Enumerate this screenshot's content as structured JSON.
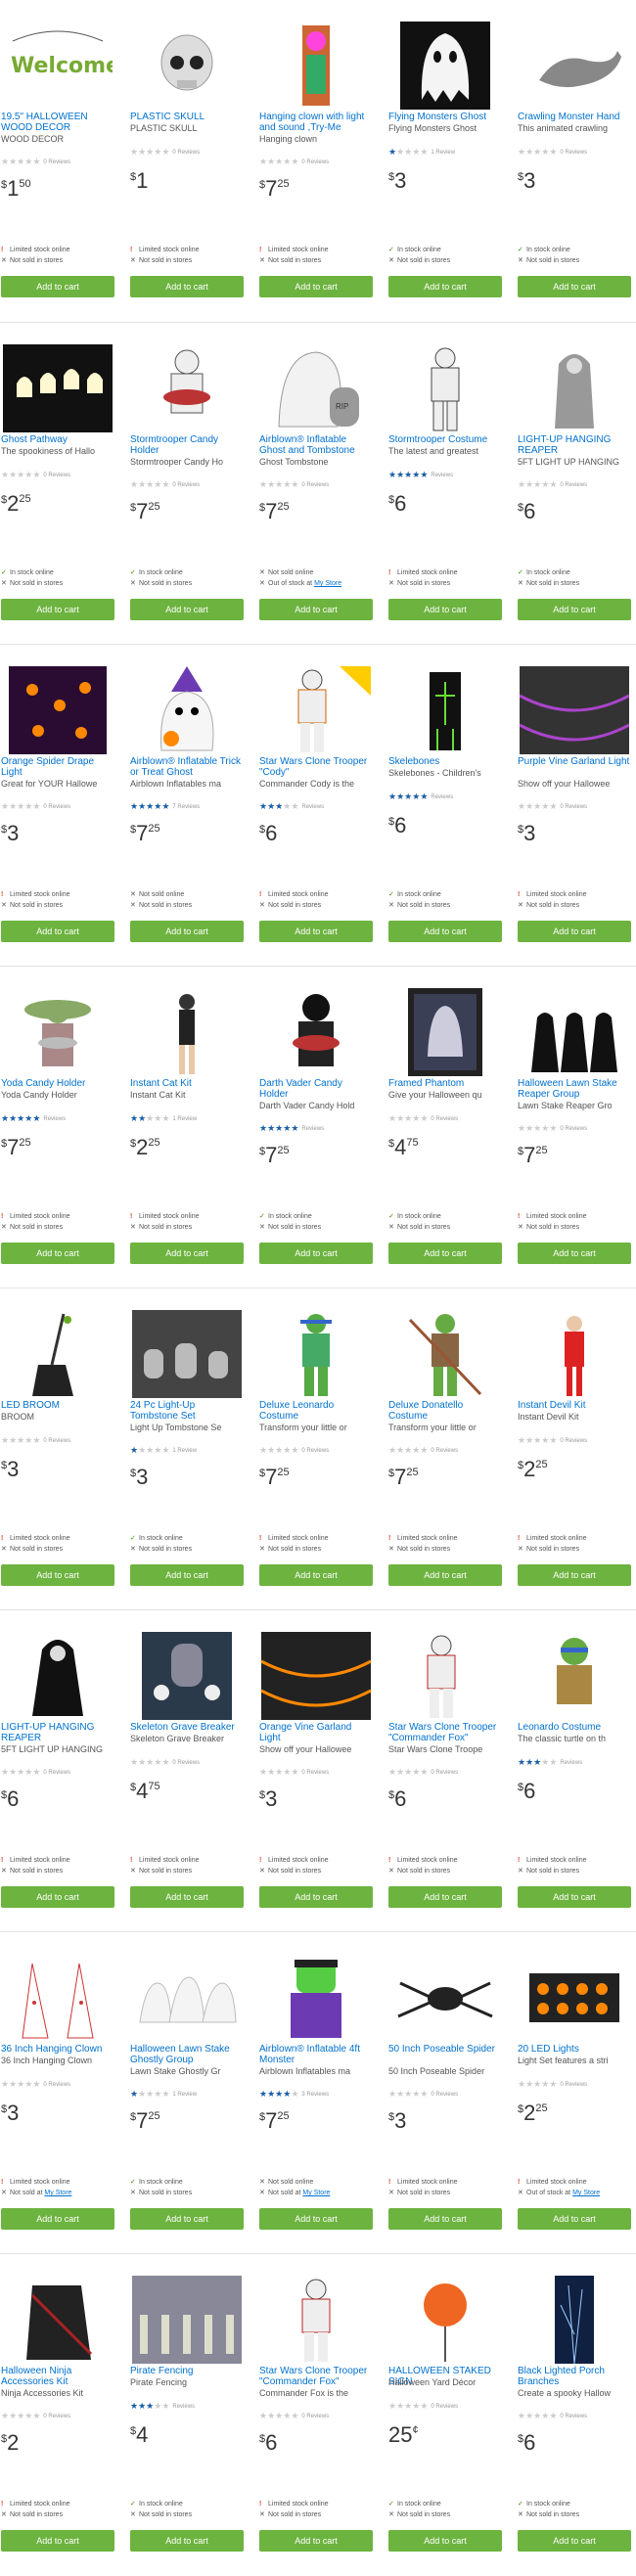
{
  "add_to_cart_label": "Add to cart",
  "products": [
    {
      "title": "19.5\" HALLOWEEN WOOD DECOR",
      "desc": "WOOD DECOR",
      "stars": 0,
      "reviews": "0 Reviews",
      "price_whole": "1",
      "price_cents": "50",
      "avail": [
        {
          "type": "warn",
          "text": "Limited stock online"
        },
        {
          "type": "no",
          "text": "Not sold in stores"
        }
      ],
      "image": "welcome-sign"
    },
    {
      "title": "PLASTIC SKULL",
      "desc": "PLASTIC SKULL",
      "stars": 0,
      "reviews": "0 Reviews",
      "price_whole": "1",
      "price_cents": "",
      "avail": [
        {
          "type": "warn",
          "text": "Limited stock online"
        },
        {
          "type": "no",
          "text": "Not sold in stores"
        }
      ],
      "image": "skull"
    },
    {
      "title": "Hanging clown with light and sound ,Try-Me",
      "desc": "Hanging clown",
      "stars": 0,
      "reviews": "0 Reviews",
      "price_whole": "7",
      "price_cents": "25",
      "avail": [
        {
          "type": "warn",
          "text": "Limited stock online"
        },
        {
          "type": "no",
          "text": "Not sold in stores"
        }
      ],
      "image": "clown"
    },
    {
      "title": "Flying Monsters Ghost",
      "desc": "Flying Monsters Ghost",
      "stars": 1,
      "reviews": "1 Review",
      "price_whole": "3",
      "price_cents": "",
      "avail": [
        {
          "type": "ok",
          "text": "In stock online"
        },
        {
          "type": "no",
          "text": "Not sold in stores"
        }
      ],
      "image": "ghost"
    },
    {
      "title": "Crawling Monster Hand",
      "desc": "This animated crawling",
      "stars": 0,
      "reviews": "0 Reviews",
      "price_whole": "3",
      "price_cents": "",
      "avail": [
        {
          "type": "ok",
          "text": "In stock online"
        },
        {
          "type": "no",
          "text": "Not sold in stores"
        }
      ],
      "image": "hand"
    },
    {
      "title": "Ghost Pathway",
      "desc": "The spookiness of Hallo",
      "stars": 0,
      "reviews": "0 Reviews",
      "price_whole": "2",
      "price_cents": "25",
      "avail": [
        {
          "type": "ok",
          "text": "In stock online"
        },
        {
          "type": "no",
          "text": "Not sold in stores"
        }
      ],
      "image": "pathway"
    },
    {
      "title": "Stormtrooper Candy Holder",
      "desc": "Stormtrooper Candy Ho",
      "stars": 0,
      "reviews": "0 Reviews",
      "price_whole": "7",
      "price_cents": "25",
      "avail": [
        {
          "type": "ok",
          "text": "In stock online"
        },
        {
          "type": "no",
          "text": "Not sold in stores"
        }
      ],
      "image": "trooper-bowl"
    },
    {
      "title": "Airblown® Inflatable Ghost and Tombstone",
      "desc": "Ghost Tombstone",
      "stars": 0,
      "reviews": "0 Reviews",
      "price_whole": "7",
      "price_cents": "25",
      "avail": [
        {
          "type": "no",
          "text": "Not sold online"
        },
        {
          "type": "no",
          "text": "Out of stock at ",
          "link": "My Store"
        }
      ],
      "image": "inflatable-ghost"
    },
    {
      "title": "Stormtrooper Costume",
      "desc": "The latest and greatest",
      "stars": 5,
      "reviews": "Reviews",
      "price_whole": "6",
      "price_cents": "",
      "avail": [
        {
          "type": "warn",
          "text": "Limited stock online"
        },
        {
          "type": "no",
          "text": "Not sold in stores"
        }
      ],
      "image": "trooper-kid"
    },
    {
      "title": "LIGHT-UP HANGING REAPER",
      "desc": "5FT LIGHT UP HANGING",
      "stars": 0,
      "reviews": "0 Reviews",
      "price_whole": "6",
      "price_cents": "",
      "avail": [
        {
          "type": "ok",
          "text": "In stock online"
        },
        {
          "type": "no",
          "text": "Not sold in stores"
        }
      ],
      "image": "reaper-grey"
    },
    {
      "title": "Orange Spider Drape Light",
      "desc": "Great for YOUR Hallowe",
      "stars": 0,
      "reviews": "0 Reviews",
      "price_whole": "3",
      "price_cents": "",
      "avail": [
        {
          "type": "warn",
          "text": "Limited stock online"
        },
        {
          "type": "no",
          "text": "Not sold in stores"
        }
      ],
      "image": "spider-lights"
    },
    {
      "title": "Airblown® Inflatable Trick or Treat Ghost",
      "desc": "Airblown Inflatables ma",
      "stars": 5,
      "reviews": "7 Reviews",
      "price_whole": "7",
      "price_cents": "25",
      "avail": [
        {
          "type": "no",
          "text": "Not sold online"
        },
        {
          "type": "no",
          "text": "Not sold in stores"
        }
      ],
      "image": "witch-ghost"
    },
    {
      "title": "Star Wars Clone Trooper \"Cody\"",
      "desc": "Commander Cody is the",
      "stars": 3,
      "reviews": "Reviews",
      "price_whole": "6",
      "price_cents": "",
      "avail": [
        {
          "type": "warn",
          "text": "Limited stock online"
        },
        {
          "type": "no",
          "text": "Not sold in stores"
        }
      ],
      "image": "clone-cody"
    },
    {
      "title": "Skelebones",
      "desc": "Skelebones - Children's",
      "stars": 5,
      "reviews": "Reviews",
      "price_whole": "6",
      "price_cents": "",
      "avail": [
        {
          "type": "ok",
          "text": "In stock online"
        },
        {
          "type": "no",
          "text": "Not sold in stores"
        }
      ],
      "image": "skelebones"
    },
    {
      "title": "Purple Vine Garland Light",
      "desc": "Show off your Hallowee",
      "stars": 0,
      "reviews": "0 Reviews",
      "price_whole": "3",
      "price_cents": "",
      "avail": [
        {
          "type": "warn",
          "text": "Limited stock online"
        },
        {
          "type": "no",
          "text": "Not sold in stores"
        }
      ],
      "image": "garland-purple"
    },
    {
      "title": "Yoda Candy Holder",
      "desc": "Yoda Candy Holder",
      "stars": 5,
      "reviews": "Reviews",
      "price_whole": "7",
      "price_cents": "25",
      "avail": [
        {
          "type": "warn",
          "text": "Limited stock online"
        },
        {
          "type": "no",
          "text": "Not sold in stores"
        }
      ],
      "image": "yoda"
    },
    {
      "title": "Instant Cat Kit",
      "desc": "Instant Cat Kit",
      "stars": 2,
      "reviews": "1 Review",
      "price_whole": "2",
      "price_cents": "25",
      "avail": [
        {
          "type": "warn",
          "text": "Limited stock online"
        },
        {
          "type": "no",
          "text": "Not sold in stores"
        }
      ],
      "image": "cat-kit"
    },
    {
      "title": "Darth Vader Candy Holder",
      "desc": "Darth Vader Candy Hold",
      "stars": 5,
      "reviews": "Reviews",
      "price_whole": "7",
      "price_cents": "25",
      "avail": [
        {
          "type": "ok",
          "text": "In stock online"
        },
        {
          "type": "no",
          "text": "Not sold in stores"
        }
      ],
      "image": "vader"
    },
    {
      "title": "Framed Phantom",
      "desc": "Give your Halloween qu",
      "stars": 0,
      "reviews": "0 Reviews",
      "price_whole": "4",
      "price_cents": "75",
      "avail": [
        {
          "type": "ok",
          "text": "In stock online"
        },
        {
          "type": "no",
          "text": "Not sold in stores"
        }
      ],
      "image": "phantom"
    },
    {
      "title": "Halloween Lawn Stake Reaper Group",
      "desc": "Lawn Stake Reaper Gro",
      "stars": 0,
      "reviews": "0 Reviews",
      "price_whole": "7",
      "price_cents": "25",
      "avail": [
        {
          "type": "warn",
          "text": "Limited stock online"
        },
        {
          "type": "no",
          "text": "Not sold in stores"
        }
      ],
      "image": "reaper-group"
    },
    {
      "title": "LED BROOM",
      "desc": "BROOM",
      "stars": 0,
      "reviews": "0 Reviews",
      "price_whole": "3",
      "price_cents": "",
      "avail": [
        {
          "type": "warn",
          "text": "Limited stock online"
        },
        {
          "type": "no",
          "text": "Not sold in stores"
        }
      ],
      "image": "broom"
    },
    {
      "title": "24 Pc Light-Up Tombstone Set",
      "desc": "Light Up Tombstone Se",
      "stars": 1,
      "reviews": "1 Review",
      "price_whole": "3",
      "price_cents": "",
      "avail": [
        {
          "type": "ok",
          "text": "In stock online"
        },
        {
          "type": "no",
          "text": "Not sold in stores"
        }
      ],
      "image": "tombstones"
    },
    {
      "title": "Deluxe Leonardo Costume",
      "desc": "Transform your little or",
      "stars": 0,
      "reviews": "0 Reviews",
      "price_whole": "7",
      "price_cents": "25",
      "avail": [
        {
          "type": "warn",
          "text": "Limited stock online"
        },
        {
          "type": "no",
          "text": "Not sold in stores"
        }
      ],
      "image": "leonardo"
    },
    {
      "title": "Deluxe Donatello Costume",
      "desc": "Transform your little or",
      "stars": 0,
      "reviews": "0 Reviews",
      "price_whole": "7",
      "price_cents": "25",
      "avail": [
        {
          "type": "warn",
          "text": "Limited stock online"
        },
        {
          "type": "no",
          "text": "Not sold in stores"
        }
      ],
      "image": "donatello"
    },
    {
      "title": "Instant Devil Kit",
      "desc": "Instant Devil Kit",
      "stars": 0,
      "reviews": "0 Reviews",
      "price_whole": "2",
      "price_cents": "25",
      "avail": [
        {
          "type": "warn",
          "text": "Limited stock online"
        },
        {
          "type": "no",
          "text": "Not sold in stores"
        }
      ],
      "image": "devil"
    },
    {
      "title": "LIGHT-UP HANGING REAPER",
      "desc": "5FT LIGHT UP HANGING",
      "stars": 0,
      "reviews": "0 Reviews",
      "price_whole": "6",
      "price_cents": "",
      "avail": [
        {
          "type": "warn",
          "text": "Limited stock online"
        },
        {
          "type": "no",
          "text": "Not sold in stores"
        }
      ],
      "image": "reaper-black"
    },
    {
      "title": "Skeleton Grave Breaker",
      "desc": "Skeleton Grave Breaker",
      "stars": 0,
      "reviews": "0 Reviews",
      "price_whole": "4",
      "price_cents": "75",
      "avail": [
        {
          "type": "warn",
          "text": "Limited stock online"
        },
        {
          "type": "no",
          "text": "Not sold in stores"
        }
      ],
      "image": "grave-breaker"
    },
    {
      "title": "Orange Vine Garland Light",
      "desc": "Show off your Hallowee",
      "stars": 0,
      "reviews": "0 Reviews",
      "price_whole": "3",
      "price_cents": "",
      "avail": [
        {
          "type": "warn",
          "text": "Limited stock online"
        },
        {
          "type": "no",
          "text": "Not sold in stores"
        }
      ],
      "image": "garland-orange"
    },
    {
      "title": "Star Wars Clone Trooper \"Commander Fox\"",
      "desc": "Star Wars Clone Troope",
      "stars": 0,
      "reviews": "0 Reviews",
      "price_whole": "6",
      "price_cents": "",
      "avail": [
        {
          "type": "warn",
          "text": "Limited stock online"
        },
        {
          "type": "no",
          "text": "Not sold in stores"
        }
      ],
      "image": "clone-fox"
    },
    {
      "title": "Leonardo Costume",
      "desc": "The classic turtle on th",
      "stars": 3,
      "reviews": "Reviews",
      "price_whole": "6",
      "price_cents": "",
      "avail": [
        {
          "type": "warn",
          "text": "Limited stock online"
        },
        {
          "type": "no",
          "text": "Not sold in stores"
        }
      ],
      "image": "leonardo-kid"
    },
    {
      "title": "36 Inch Hanging Clown",
      "desc": "36 Inch Hanging Clown",
      "stars": 0,
      "reviews": "0 Reviews",
      "price_whole": "3",
      "price_cents": "",
      "avail": [
        {
          "type": "warn",
          "text": "Limited stock online"
        },
        {
          "type": "no",
          "text": "Not sold at ",
          "link": "My Store"
        }
      ],
      "image": "clowns-hanging"
    },
    {
      "title": "Halloween Lawn Stake Ghostly Group",
      "desc": "Lawn Stake Ghostly Gr",
      "stars": 1,
      "reviews": "1 Review",
      "price_whole": "7",
      "price_cents": "25",
      "avail": [
        {
          "type": "ok",
          "text": "In stock online"
        },
        {
          "type": "no",
          "text": "Not sold in stores"
        }
      ],
      "image": "ghostly-group"
    },
    {
      "title": "Airblown® Inflatable 4ft Monster",
      "desc": "Airblown Inflatables ma",
      "stars": 4,
      "reviews": "3 Reviews",
      "price_whole": "7",
      "price_cents": "25",
      "avail": [
        {
          "type": "no",
          "text": "Not sold online"
        },
        {
          "type": "no",
          "text": "Not sold at ",
          "link": "My Store"
        }
      ],
      "image": "frankenstein"
    },
    {
      "title": "50 Inch Poseable Spider",
      "desc": "50 Inch Poseable Spider",
      "stars": 0,
      "reviews": "0 Reviews",
      "price_whole": "3",
      "price_cents": "",
      "avail": [
        {
          "type": "warn",
          "text": "Limited stock online"
        },
        {
          "type": "no",
          "text": "Not sold in stores"
        }
      ],
      "image": "spider"
    },
    {
      "title": "20 LED Lights",
      "desc": "Light Set features a stri",
      "stars": 0,
      "reviews": "0 Reviews",
      "price_whole": "2",
      "price_cents": "25",
      "avail": [
        {
          "type": "warn",
          "text": "Limited stock online"
        },
        {
          "type": "no",
          "text": "Out of stock at ",
          "link": "My Store"
        }
      ],
      "image": "pumpkin-lights"
    },
    {
      "title": "Halloween Ninja Accessories Kit",
      "desc": "Ninja Accessories Kit",
      "stars": 0,
      "reviews": "0 Reviews",
      "price_whole": "2",
      "price_cents": "",
      "avail": [
        {
          "type": "warn",
          "text": "Limited stock online"
        },
        {
          "type": "no",
          "text": "Not sold in stores"
        }
      ],
      "image": "ninja"
    },
    {
      "title": "Pirate Fencing",
      "desc": "Pirate Fencing",
      "stars": 3,
      "reviews": "Reviews",
      "price_whole": "4",
      "price_cents": "",
      "avail": [
        {
          "type": "ok",
          "text": "In stock online"
        },
        {
          "type": "no",
          "text": "Not sold in stores"
        }
      ],
      "image": "pirate-fence"
    },
    {
      "title": "Star Wars Clone Trooper \"Commander Fox\"",
      "desc": "Commander Fox is the",
      "stars": 0,
      "reviews": "0 Reviews",
      "price_whole": "6",
      "price_cents": "",
      "avail": [
        {
          "type": "warn",
          "text": "Limited stock online"
        },
        {
          "type": "no",
          "text": "Not sold in stores"
        }
      ],
      "image": "clone-fox2"
    },
    {
      "title": "HALLOWEEN STAKED SIGN",
      "desc": "Halloween Yard Décor",
      "stars": 0,
      "reviews": "0 Reviews",
      "price_whole": "25",
      "price_cents": "¢",
      "avail": [
        {
          "type": "ok",
          "text": "In stock online"
        },
        {
          "type": "no",
          "text": "Not sold in stores"
        }
      ],
      "image": "pumpkin-sign"
    },
    {
      "title": "Black Lighted Porch Branches",
      "desc": "Create a spooky Hallow",
      "stars": 0,
      "reviews": "0 Reviews",
      "price_whole": "6",
      "price_cents": "",
      "avail": [
        {
          "type": "ok",
          "text": "In stock online"
        },
        {
          "type": "no",
          "text": "Not sold in stores"
        }
      ],
      "image": "porch-branches"
    }
  ]
}
